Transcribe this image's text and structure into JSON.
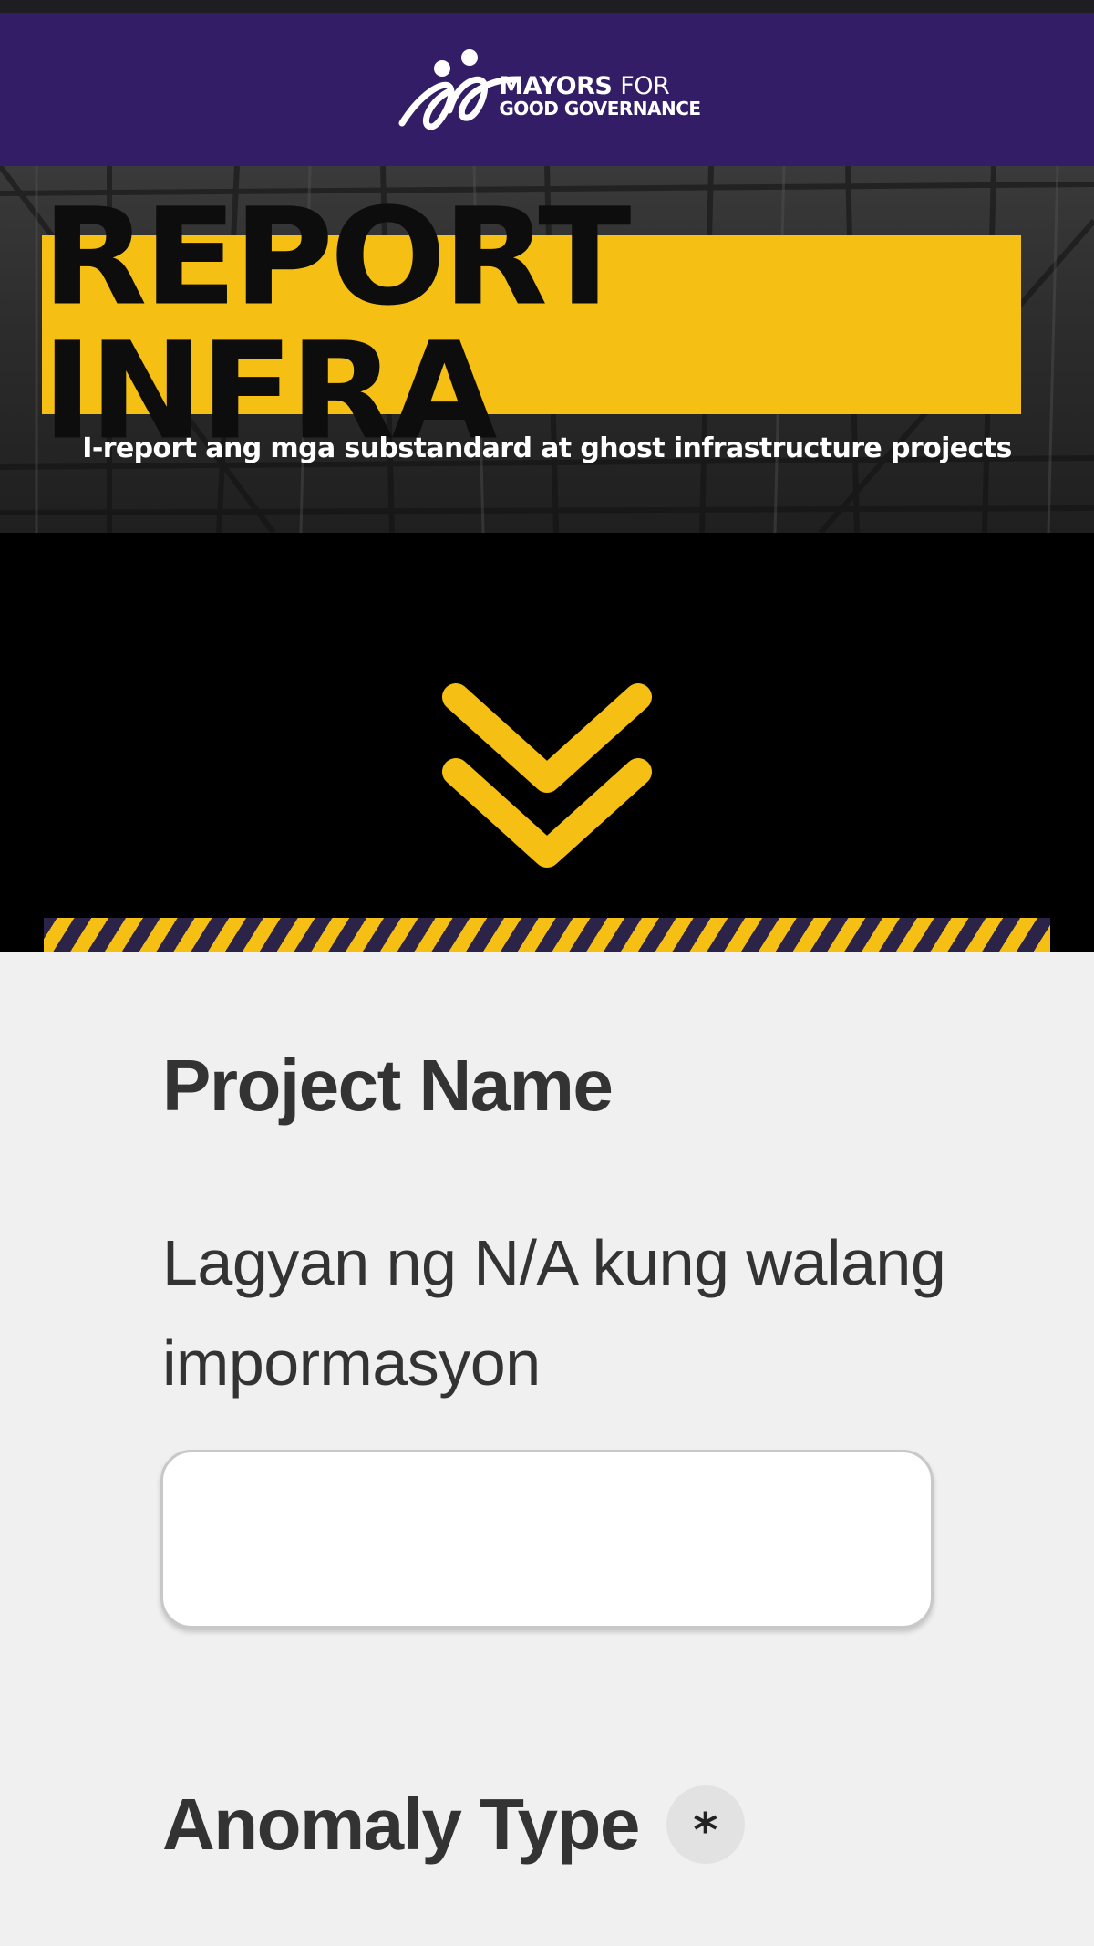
{
  "header": {
    "logo": {
      "line1_bold": "MAYORS",
      "line1_light": "FOR",
      "line2": "GOOD GOVERNANCE",
      "icon": "people-swoosh-logo-icon"
    },
    "background_color": "#331d66"
  },
  "hero": {
    "title": "REPORT INFRA",
    "subtitle": "I-report ang mga substandard at ghost infrastructure projects",
    "title_box_color": "#f5c013"
  },
  "scroll_cue": {
    "icon": "double-chevron-down-icon",
    "color": "#f5c013"
  },
  "hazard_stripe": {
    "colors": [
      "#f5c013",
      "#2b2448"
    ]
  },
  "form": {
    "project_name": {
      "label": "Project Name",
      "helper": "Lagyan ng N/A kung walang impormasyon",
      "value": ""
    },
    "anomaly_type": {
      "label": "Anomaly Type",
      "required_marker": "*"
    }
  }
}
